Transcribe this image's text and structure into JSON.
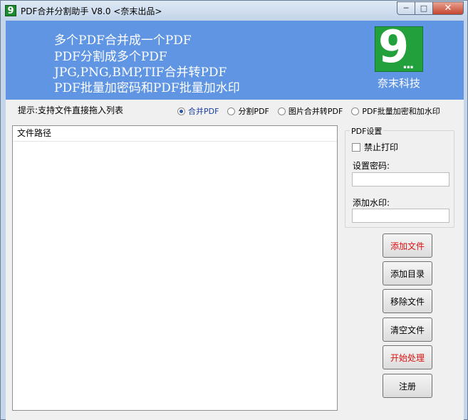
{
  "window": {
    "title": "PDF合并分割助手 V8.0 <奈末出品>",
    "icon_label": "9",
    "controls": {
      "minimize": "─",
      "maximize": "□",
      "close": "✕"
    }
  },
  "banner": {
    "lines": [
      "多个PDF合并成一个PDF",
      "PDF分割成多个PDF",
      "JPG,PNG,BMP,TIF合并转PDF",
      "PDF批量加密码和PDF批量加水印"
    ],
    "logo_mark": "9",
    "logo_dots": "...",
    "logo_text": "奈末科技"
  },
  "hint": "提示:支持文件直接拖入列表",
  "modes": [
    {
      "label": "合并PDF",
      "selected": true
    },
    {
      "label": "分割PDF",
      "selected": false
    },
    {
      "label": "图片合并转PDF",
      "selected": false
    },
    {
      "label": "PDF批量加密和加水印",
      "selected": false
    }
  ],
  "file_list": {
    "column_header": "文件路径"
  },
  "pdf_settings": {
    "group_title": "PDF设置",
    "disable_print_label": "禁止打印",
    "disable_print_checked": false,
    "password_label": "设置密码:",
    "password_value": "",
    "watermark_label": "添加水印:",
    "watermark_value": ""
  },
  "buttons": {
    "add_file": "添加文件",
    "add_folder": "添加目录",
    "remove_file": "移除文件",
    "clear_files": "清空文件",
    "start": "开始处理",
    "register": "注册"
  },
  "colors": {
    "banner": "#5f95e2",
    "logo": "#22a03b",
    "accent_red": "#e01010"
  }
}
